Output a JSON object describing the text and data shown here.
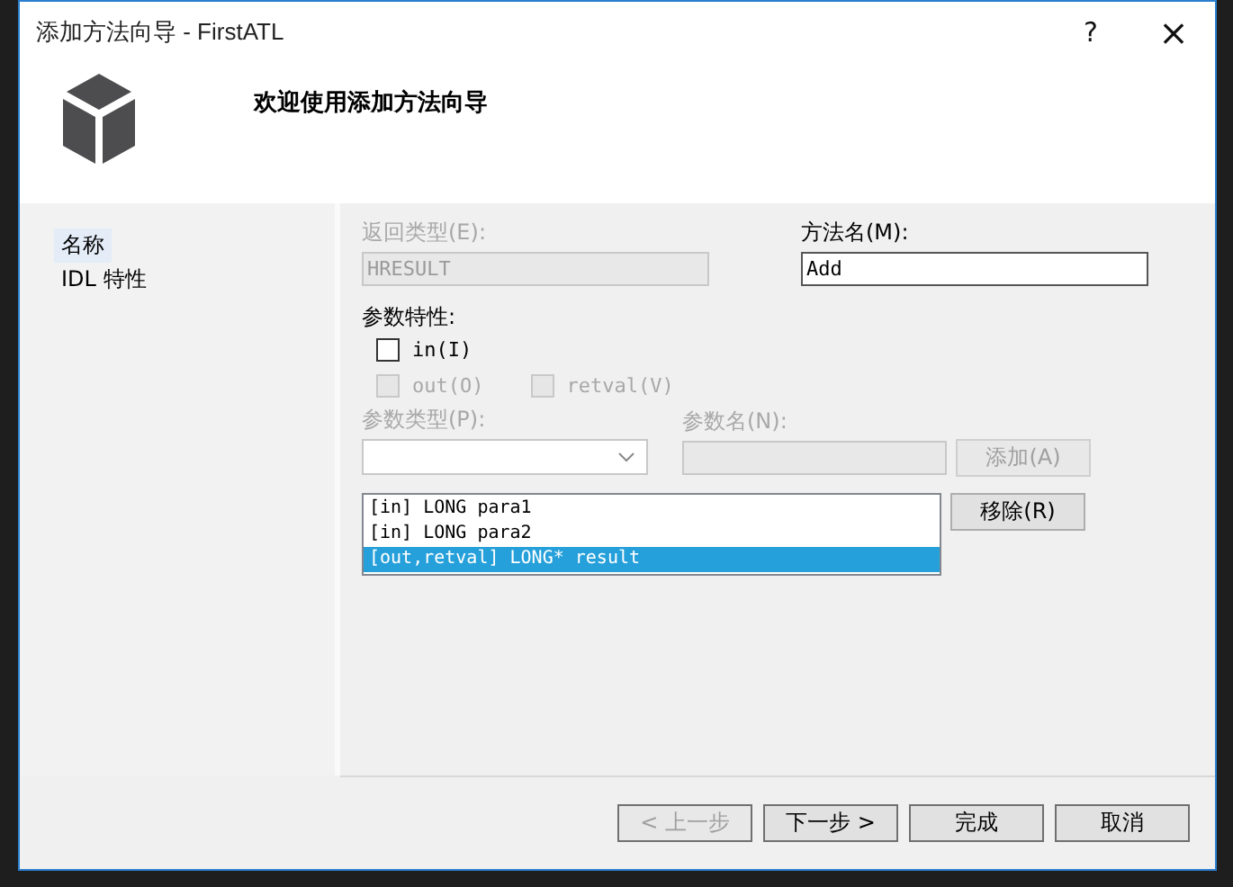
{
  "window": {
    "title": "添加方法向导 - FirstATL",
    "help": "?",
    "close": "×"
  },
  "header": {
    "title": "欢迎使用添加方法向导"
  },
  "sidebar": {
    "items": [
      {
        "label": "名称",
        "selected": true
      },
      {
        "label": "IDL 特性",
        "selected": false
      }
    ]
  },
  "form": {
    "return_type": {
      "label": "返回类型(E):",
      "value": "HRESULT",
      "disabled": true
    },
    "method_name": {
      "label": "方法名(M):",
      "value": "Add",
      "disabled": false
    },
    "param_attributes": {
      "label": "参数特性:",
      "checkboxes": [
        {
          "label": "in(I)",
          "checked": false,
          "disabled": false
        },
        {
          "label": "out(O)",
          "checked": false,
          "disabled": true
        },
        {
          "label": "retval(V)",
          "checked": false,
          "disabled": true
        }
      ]
    },
    "param_type": {
      "label": "参数类型(P):",
      "disabled": true
    },
    "param_name": {
      "label": "参数名(N):",
      "disabled": true
    },
    "add_button": {
      "label": "添加(A)",
      "disabled": true
    },
    "remove_button": {
      "label": "移除(R)",
      "disabled": false
    },
    "params": [
      {
        "text": "[in] LONG para1",
        "selected": false
      },
      {
        "text": "[in] LONG para2",
        "selected": false
      },
      {
        "text": "[out,retval] LONG* result",
        "selected": true
      }
    ]
  },
  "buttons": [
    {
      "label": "< 上一步",
      "disabled": true
    },
    {
      "label": "下一步 >",
      "disabled": false
    },
    {
      "label": "完成",
      "disabled": false
    },
    {
      "label": "取消",
      "disabled": false
    }
  ]
}
